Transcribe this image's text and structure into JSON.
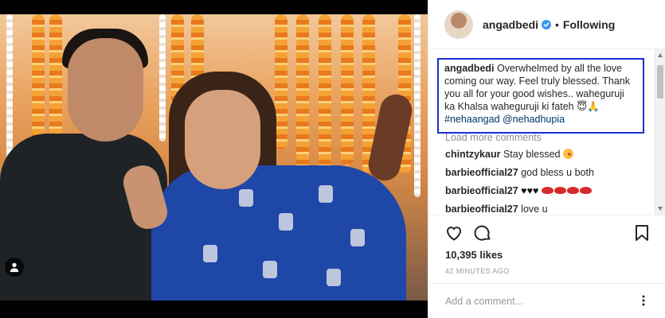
{
  "post": {
    "username": "angadbedi",
    "follow_status": "Following",
    "separator": "•"
  },
  "caption": {
    "username": "angadbedi",
    "text": " Overwhelmed by all the love coming our way. Feel truly blessed. Thank you all for your good wishes.. waheguruji ka Khalsa waheguruji ki fateh 😇🙏",
    "tags": "#nehaangad @nehadhupia"
  },
  "load_more": "Load more comments",
  "comments": [
    {
      "username": "chintzykaur",
      "text": " Stay blessed"
    },
    {
      "username": "barbieofficial27",
      "text": " god bless u both"
    },
    {
      "username": "barbieofficial27",
      "text": " ♥♥♥"
    },
    {
      "username": "barbieofficial27",
      "text": " love u"
    }
  ],
  "likes": "10,395 likes",
  "time": "42 MINUTES AGO",
  "add_comment_placeholder": "Add a comment...",
  "icons": {
    "like": "heart-outline-icon",
    "comment": "speech-bubble-icon",
    "save": "bookmark-icon",
    "more": "ellipsis-icon",
    "verified": "verified-badge-icon",
    "tagged": "user-tag-icon"
  },
  "colors": {
    "highlight_box": "#1c2fd3",
    "verified": "#3897f0",
    "link": "#003569"
  }
}
